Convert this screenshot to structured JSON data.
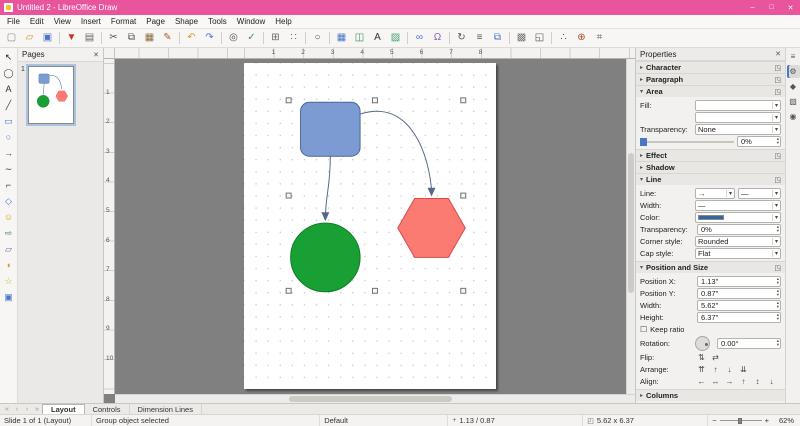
{
  "window": {
    "title": "Untitled 2 - LibreOffice Draw",
    "controls": {
      "minimize": "–",
      "maximize": "□",
      "close": "✕"
    }
  },
  "colors": {
    "titlebar": "#e8559d",
    "canvas_background": "#808080",
    "accent_blue": "#4a76c6"
  },
  "icons": {
    "collapsed": "▸",
    "expanded": "▾",
    "dialog_launcher": "◳",
    "close": "✕",
    "dropdown": "▾",
    "spin_up": "▴",
    "spin_down": "▾",
    "checkbox_unchecked": "☐",
    "position_status": "+",
    "size_status": "◰"
  },
  "menubar": {
    "items": [
      "File",
      "Edit",
      "View",
      "Insert",
      "Format",
      "Page",
      "Shape",
      "Tools",
      "Window",
      "Help"
    ]
  },
  "toolbar": {
    "items": [
      {
        "name": "new",
        "glyph": "▢",
        "color": "#8a8a8a"
      },
      {
        "name": "open",
        "glyph": "▱",
        "color": "#c8922b"
      },
      {
        "name": "save",
        "glyph": "▣",
        "color": "#4a76c6"
      },
      {
        "sep": true
      },
      {
        "name": "export-pdf",
        "glyph": "▼",
        "color": "#c0392b"
      },
      {
        "name": "print",
        "glyph": "▤",
        "color": "#666666"
      },
      {
        "sep": true
      },
      {
        "name": "cut",
        "glyph": "✂",
        "color": "#555555"
      },
      {
        "name": "copy",
        "glyph": "⧉",
        "color": "#555555"
      },
      {
        "name": "paste",
        "glyph": "▦",
        "color": "#8a6d3b"
      },
      {
        "name": "clone-formatting",
        "glyph": "✎",
        "color": "#b05c2a"
      },
      {
        "sep": true
      },
      {
        "name": "undo",
        "glyph": "↶",
        "color": "#d59c20"
      },
      {
        "name": "redo",
        "glyph": "↷",
        "color": "#3f76d4"
      },
      {
        "sep": true
      },
      {
        "name": "find-replace",
        "glyph": "◎",
        "color": "#555555"
      },
      {
        "name": "spelling",
        "glyph": "✓",
        "color": "#2e9e4f"
      },
      {
        "sep": true
      },
      {
        "name": "display-grid",
        "glyph": "⊞",
        "color": "#666666"
      },
      {
        "name": "snap-guides",
        "glyph": "∷",
        "color": "#666666"
      },
      {
        "sep": true
      },
      {
        "name": "zoom",
        "glyph": "○",
        "color": "#444444"
      },
      {
        "sep": true
      },
      {
        "name": "insert-table",
        "glyph": "▦",
        "color": "#4a76c6"
      },
      {
        "name": "insert-chart",
        "glyph": "◫",
        "color": "#3f8f5f"
      },
      {
        "name": "insert-text-box",
        "glyph": "A",
        "color": "#333333"
      },
      {
        "name": "insert-image",
        "glyph": "▨",
        "color": "#4a9e6e"
      },
      {
        "sep": true
      },
      {
        "name": "insert-hyperlink",
        "glyph": "∞",
        "color": "#3f76d4"
      },
      {
        "name": "special-character",
        "glyph": "Ω",
        "color": "#8a5fb0"
      },
      {
        "sep": true
      },
      {
        "name": "transformations",
        "glyph": "↻",
        "color": "#555555"
      },
      {
        "name": "align-objects",
        "glyph": "≡",
        "color": "#555555"
      },
      {
        "name": "arrange",
        "glyph": "⧉",
        "color": "#4a76c6"
      },
      {
        "sep": true
      },
      {
        "name": "shadow",
        "glyph": "▩",
        "color": "#777777"
      },
      {
        "name": "crop-image",
        "glyph": "◱",
        "color": "#555555"
      },
      {
        "sep": true
      },
      {
        "name": "points",
        "glyph": "∴",
        "color": "#555555"
      },
      {
        "name": "glue-points",
        "glyph": "⊕",
        "color": "#b04a2a"
      },
      {
        "name": "helplines-while-moving",
        "glyph": "⌗",
        "color": "#666666"
      }
    ]
  },
  "drawing_toolbar": {
    "items": [
      {
        "name": "select",
        "glyph": "↖",
        "color": "#222222"
      },
      {
        "name": "zoom-pan",
        "glyph": "◯",
        "color": "#444444"
      },
      {
        "name": "insert-text-box",
        "glyph": "A",
        "color": "#333333"
      },
      {
        "name": "insert-line",
        "glyph": "╱",
        "color": "#444444"
      },
      {
        "name": "rectangle",
        "glyph": "▭",
        "color": "#4a76c6"
      },
      {
        "name": "ellipse",
        "glyph": "○",
        "color": "#4a76c6"
      },
      {
        "name": "lines-and-arrows",
        "glyph": "→",
        "color": "#444444"
      },
      {
        "name": "curves-and-polygons",
        "glyph": "∼",
        "color": "#444444"
      },
      {
        "name": "connectors",
        "glyph": "⌐",
        "color": "#444444"
      },
      {
        "name": "basic-shapes",
        "glyph": "◇",
        "color": "#4a76c6"
      },
      {
        "name": "symbol-shapes",
        "glyph": "☺",
        "color": "#d59c20"
      },
      {
        "name": "block-arrows",
        "glyph": "⇨",
        "color": "#3f8f5f"
      },
      {
        "name": "flowchart",
        "glyph": "▱",
        "color": "#8a5fb0"
      },
      {
        "name": "callouts",
        "glyph": "◖",
        "color": "#d59c20"
      },
      {
        "name": "stars-and-banners",
        "glyph": "☆",
        "color": "#d5b120"
      },
      {
        "name": "3d-objects",
        "glyph": "▣",
        "color": "#4a76c6"
      }
    ]
  },
  "pages_panel": {
    "title": "Pages",
    "pages": [
      {
        "number": "1"
      }
    ]
  },
  "rulers": {
    "horizontal": [
      "1",
      "2",
      "3",
      "4",
      "5",
      "6",
      "7",
      "8"
    ],
    "vertical": [
      "1",
      "2",
      "3",
      "4",
      "5",
      "6",
      "7",
      "8",
      "9",
      "10"
    ]
  },
  "canvas": {
    "square_fill": "#7b9bd2",
    "square_stroke": "#46679b",
    "circle_fill": "#18a035",
    "circle_stroke": "#0d7c27",
    "hexagon_fill": "#fb7a72",
    "hexagon_stroke": "#d84848",
    "connector_color": "#56688a",
    "handle_fill": "#f7f7f7",
    "handle_stroke": "#6f6f6f"
  },
  "sidebar": {
    "title": "Properties",
    "sections": {
      "character": "Character",
      "paragraph": "Paragraph",
      "area": "Area",
      "effect": "Effect",
      "shadow": "Shadow",
      "line": "Line",
      "possize": "Position and Size",
      "columns": "Columns"
    },
    "area": {
      "fill_label": "Fill:",
      "fill_style_value": "",
      "fill_color_value": "",
      "transparency_label": "Transparency:",
      "transparency_type": "None",
      "transparency_percent": "0%"
    },
    "line": {
      "line_label": "Line:",
      "arrow_style_value": "→",
      "line_style_value": "—",
      "width_label": "Width:",
      "width_value": "—",
      "color_label": "Color:",
      "color_value": "#3465a4",
      "transparency_label": "Transparency:",
      "transparency_value": "0%",
      "corner_label": "Corner style:",
      "corner_value": "Rounded",
      "cap_label": "Cap style:",
      "cap_value": "Flat"
    },
    "possize": {
      "x_label": "Position X:",
      "x_value": "1.13\"",
      "y_label": "Position Y:",
      "y_value": "0.87\"",
      "w_label": "Width:",
      "w_value": "5.62\"",
      "h_label": "Height:",
      "h_value": "6.37\"",
      "keep_ratio_label": "Keep ratio",
      "rotation_label": "Rotation:",
      "rotation_value": "0.00°",
      "flip_label": "Flip:",
      "arrange_label": "Arrange:",
      "align_label": "Align:",
      "flip_buttons": [
        {
          "name": "flip-vertically",
          "glyph": "⇅"
        },
        {
          "name": "flip-horizontally",
          "glyph": "⇄"
        }
      ],
      "arrange_buttons": [
        {
          "name": "bring-to-front",
          "glyph": "⇈"
        },
        {
          "name": "bring-forward",
          "glyph": "↑"
        },
        {
          "name": "send-backward",
          "glyph": "↓"
        },
        {
          "name": "send-to-back",
          "glyph": "⇊"
        }
      ],
      "align_buttons": [
        {
          "name": "align-left",
          "glyph": "←"
        },
        {
          "name": "align-center",
          "glyph": "↔"
        },
        {
          "name": "align-right",
          "glyph": "→"
        },
        {
          "name": "align-top",
          "glyph": "↑"
        },
        {
          "name": "align-middle",
          "glyph": "↕"
        },
        {
          "name": "align-bottom",
          "glyph": "↓"
        }
      ]
    },
    "deck_icons": [
      {
        "name": "sidebar-settings",
        "glyph": "≡",
        "active": false
      },
      {
        "name": "properties-deck",
        "glyph": "⚙",
        "active": true
      },
      {
        "name": "shapes-deck",
        "glyph": "◆",
        "active": false
      },
      {
        "name": "gallery-deck",
        "glyph": "▨",
        "active": false
      },
      {
        "name": "navigator-deck",
        "glyph": "◉",
        "active": false
      }
    ]
  },
  "tabbar": {
    "nav": [
      {
        "name": "first-page",
        "glyph": "«"
      },
      {
        "name": "previous-page",
        "glyph": "‹"
      },
      {
        "name": "next-page",
        "glyph": "›"
      },
      {
        "name": "last-page",
        "glyph": "»"
      }
    ],
    "tabs": [
      {
        "label": "Layout",
        "active": true
      },
      {
        "label": "Controls",
        "active": false
      },
      {
        "label": "Dimension Lines",
        "active": false
      }
    ]
  },
  "statusbar": {
    "slide_info": "Slide 1 of 1 (Layout)",
    "selection_info": "Group object selected",
    "style_name": "Default",
    "cursor_position": "1.13 / 0.87",
    "object_size": "5.62 x 6.37",
    "zoom_out_label": "−",
    "zoom_in_label": "+",
    "zoom_percent": "62%"
  }
}
